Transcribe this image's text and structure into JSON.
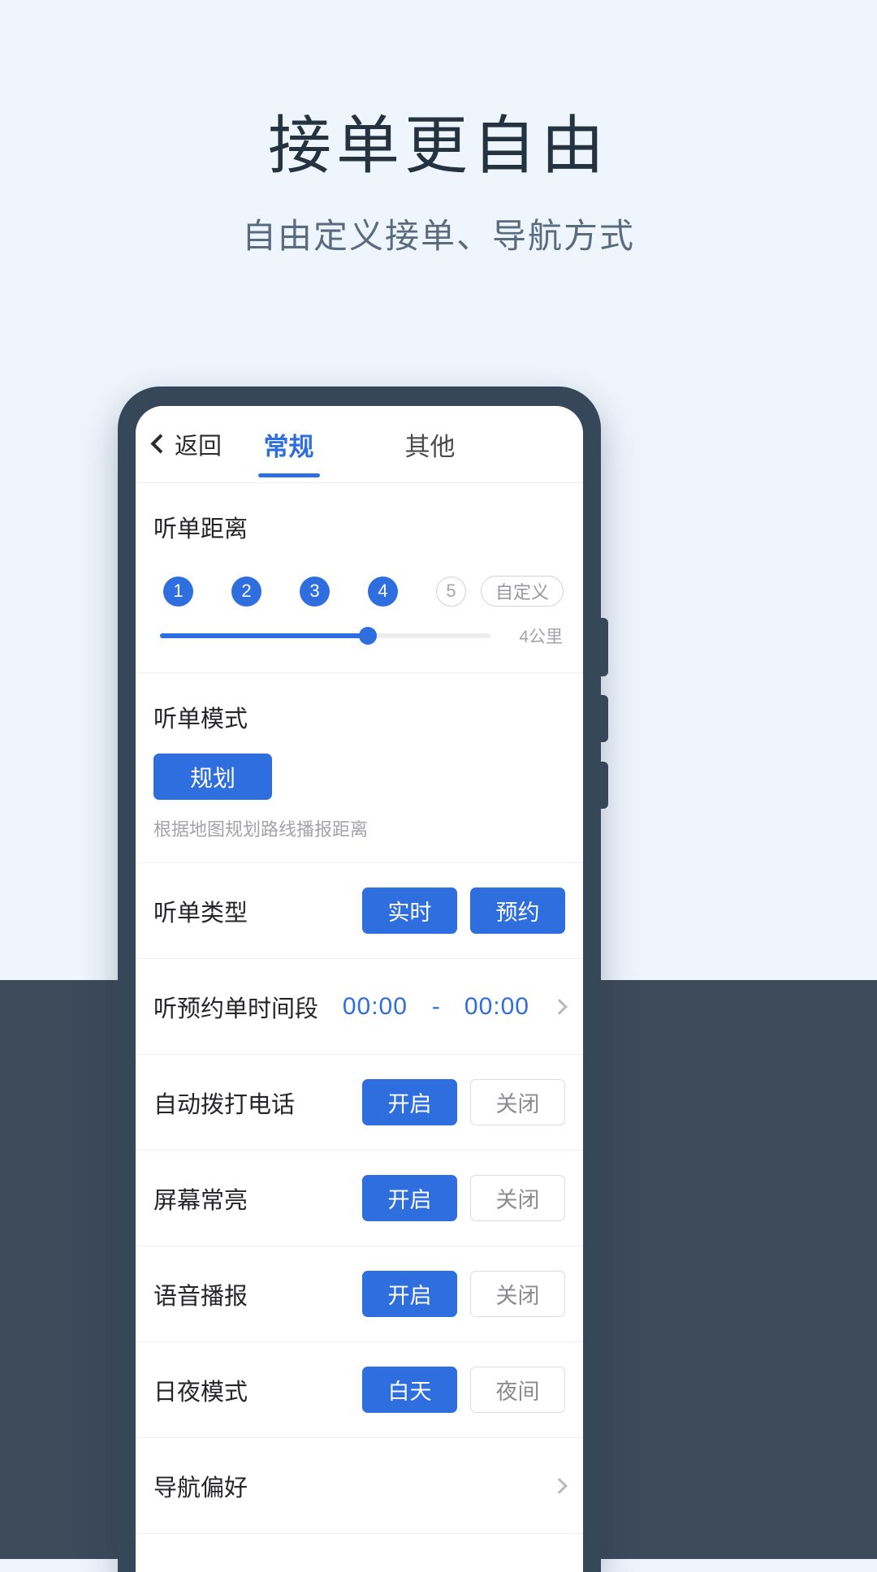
{
  "hero": {
    "title": "接单更自由",
    "subtitle": "自由定义接单、导航方式"
  },
  "colors": {
    "accent": "#2f6ede",
    "page_bg": "#eef5fd",
    "panel_bg": "#3c4a5a",
    "phone_frame": "#37475a",
    "title_text": "#25323f",
    "subtitle_text": "#5b6b7e"
  },
  "topbar": {
    "back_label": "返回",
    "back_icon": "chevron-left-icon",
    "tabs": [
      {
        "label": "常规",
        "active": true
      },
      {
        "label": "其他",
        "active": false
      }
    ]
  },
  "distance": {
    "title": "听单距离",
    "steps": [
      {
        "label": "1",
        "selected": true
      },
      {
        "label": "2",
        "selected": true
      },
      {
        "label": "3",
        "selected": true
      },
      {
        "label": "4",
        "selected": true
      },
      {
        "label": "5",
        "selected": false
      }
    ],
    "custom_label": "自定义",
    "slider_value_label": "4公里"
  },
  "mode": {
    "title": "听单模式",
    "button_label": "规划",
    "hint": "根据地图规划路线播报距离"
  },
  "rows": [
    {
      "label": "听单类型",
      "type": "segments",
      "options": [
        {
          "label": "实时",
          "selected": true
        },
        {
          "label": "预约",
          "selected": true
        }
      ]
    },
    {
      "label": "听预约单时间段",
      "type": "time-range",
      "start": "00:00",
      "separator": "-",
      "end": "00:00",
      "chevron_icon": "chevron-right-icon"
    },
    {
      "label": "自动拨打电话",
      "type": "segments",
      "options": [
        {
          "label": "开启",
          "selected": true
        },
        {
          "label": "关闭",
          "selected": false
        }
      ]
    },
    {
      "label": "屏幕常亮",
      "type": "segments",
      "options": [
        {
          "label": "开启",
          "selected": true
        },
        {
          "label": "关闭",
          "selected": false
        }
      ]
    },
    {
      "label": "语音播报",
      "type": "segments",
      "options": [
        {
          "label": "开启",
          "selected": true
        },
        {
          "label": "关闭",
          "selected": false
        }
      ]
    },
    {
      "label": "日夜模式",
      "type": "segments",
      "options": [
        {
          "label": "白天",
          "selected": true
        },
        {
          "label": "夜间",
          "selected": false
        }
      ]
    },
    {
      "label": "导航偏好",
      "type": "chevron",
      "chevron_icon": "chevron-right-icon"
    }
  ]
}
